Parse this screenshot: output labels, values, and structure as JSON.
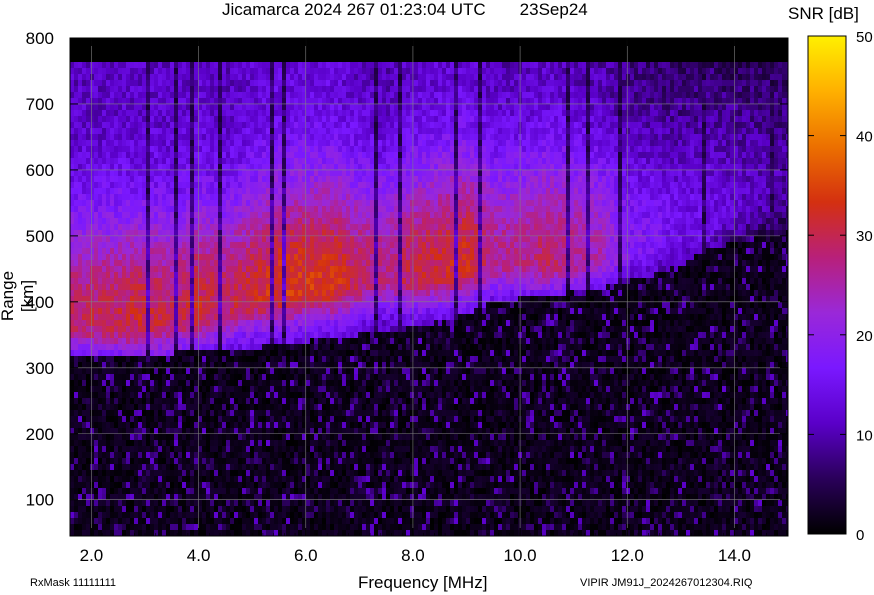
{
  "header": {
    "title": "Jicamarca 2024 267 01:23:04 UTC",
    "date": "23Sep24"
  },
  "footer": {
    "rxmask": "RxMask 11111111",
    "filename": "VIPIR  JM91J_2024267012304.RIQ"
  },
  "colorbar": {
    "label": "SNR [dB]",
    "range": [
      0,
      50
    ],
    "ticks": [
      "0",
      "10",
      "20",
      "30",
      "40",
      "50"
    ],
    "colors": [
      "#000000",
      "#2a005a",
      "#5a00c8",
      "#7a18ff",
      "#9a28d8",
      "#b8207a",
      "#d43010",
      "#ec7000",
      "#ffb000",
      "#fff000"
    ]
  },
  "chart_data": {
    "type": "heatmap",
    "title": "Jicamarca 2024 267 01:23:04 UTC",
    "xlabel": "Frequency [MHz]",
    "ylabel": "Range [km]",
    "xlim": [
      1.6,
      15.0
    ],
    "ylim": [
      45,
      800
    ],
    "xticks": [
      "2.0",
      "4.0",
      "6.0",
      "8.0",
      "10.0",
      "12.0",
      "14.0"
    ],
    "yticks": [
      "100",
      "200",
      "300",
      "400",
      "500",
      "600",
      "700",
      "800"
    ],
    "grid": true,
    "colorbar_label": "SNR [dB]",
    "trace": {
      "description_free": true,
      "frequency_mhz": [
        1.8,
        2.5,
        3.0,
        3.5,
        4.0,
        4.5,
        5.0,
        5.5,
        6.0,
        6.5,
        7.0,
        7.5,
        8.0,
        8.5,
        9.0,
        9.5,
        10.0,
        10.5,
        11.0,
        11.5,
        12.0,
        12.5,
        13.0,
        13.5,
        14.0,
        14.5,
        15.0
      ],
      "lower_range_km": [
        322,
        320,
        320,
        322,
        325,
        328,
        330,
        335,
        340,
        345,
        350,
        355,
        362,
        370,
        380,
        400,
        405,
        410,
        415,
        420,
        430,
        440,
        455,
        480,
        490,
        500,
        505
      ],
      "peak_range_km": [
        370,
        370,
        370,
        375,
        385,
        390,
        405,
        415,
        420,
        425,
        430,
        435,
        440,
        445,
        455,
        460,
        460,
        462,
        465,
        470,
        480,
        490,
        500,
        520,
        540,
        560,
        570
      ],
      "peak_snr_db": [
        24,
        25,
        26,
        24,
        26,
        24,
        26,
        28,
        28,
        28,
        24,
        22,
        25,
        26,
        27,
        22,
        22,
        24,
        22,
        20,
        15,
        14,
        12,
        12,
        10,
        9,
        8
      ]
    }
  }
}
